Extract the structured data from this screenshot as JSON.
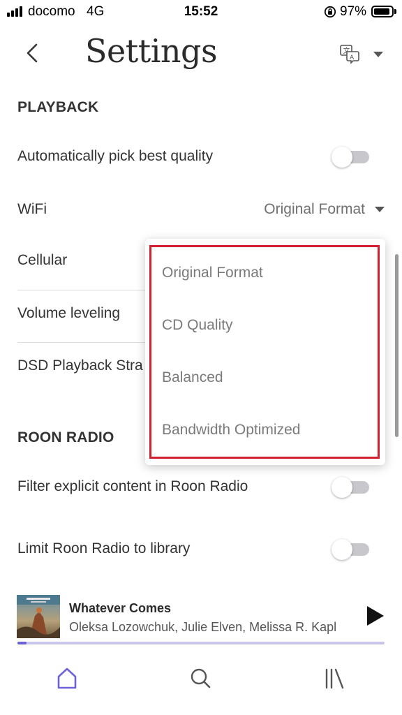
{
  "status_bar": {
    "carrier": "docomo",
    "network": "4G",
    "time": "15:52",
    "battery": "97%"
  },
  "header": {
    "title": "Settings",
    "back_icon": "chevron-left-icon",
    "language_icon": "translate-icon"
  },
  "playback": {
    "section_title": "PLAYBACK",
    "auto_quality_label": "Automatically pick best quality",
    "auto_quality_on": false,
    "wifi_label": "WiFi",
    "wifi_value": "Original Format",
    "cellular_label": "Cellular",
    "volume_leveling_label": "Volume leveling",
    "dsd_label": "DSD Playback Stra"
  },
  "dropdown": {
    "options": [
      "Original Format",
      "CD Quality",
      "Balanced",
      "Bandwidth Optimized"
    ],
    "highlight_color": "#d2202f"
  },
  "radio": {
    "section_title": "ROON RADIO",
    "filter_explicit_label": "Filter explicit content in Roon Radio",
    "filter_explicit_on": false,
    "limit_library_label": "Limit Roon Radio to library",
    "limit_library_on": false
  },
  "now_playing": {
    "title": "Whatever Comes",
    "artists": "Oleksa Lozowchuk, Julie Elven, Melissa R. Kaplan",
    "progress": 0.025,
    "accent_color": "#6c63d8"
  },
  "nav": {
    "items": [
      "home-icon",
      "search-icon",
      "library-icon"
    ]
  }
}
